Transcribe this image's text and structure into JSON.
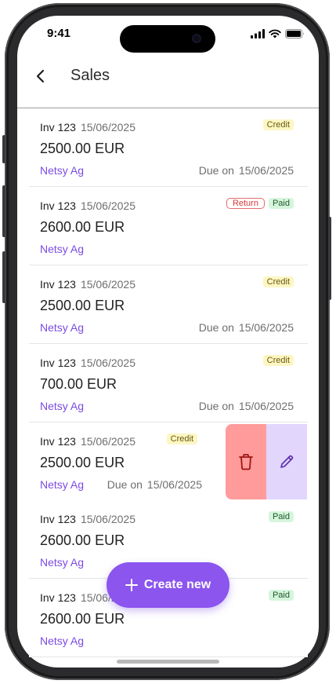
{
  "status_bar": {
    "time": "9:41",
    "icons": [
      "signal-icon",
      "wifi-icon",
      "battery-icon"
    ]
  },
  "header": {
    "title": "Sales",
    "back_icon": "chevron-left-icon"
  },
  "invoices": [
    {
      "number": "Inv 123",
      "date": "15/06/2025",
      "amount": "2500.00 EUR",
      "company": "Netsy Ag",
      "due_label": "Due on",
      "due_date": "15/06/2025",
      "badges": [
        {
          "text": "Credit",
          "kind": "credit"
        }
      ]
    },
    {
      "number": "Inv 123",
      "date": "15/06/2025",
      "amount": "2600.00 EUR",
      "company": "Netsy Ag",
      "due_label": "",
      "due_date": "",
      "badges": [
        {
          "text": "Return",
          "kind": "return"
        },
        {
          "text": "Paid",
          "kind": "paid"
        }
      ]
    },
    {
      "number": "Inv 123",
      "date": "15/06/2025",
      "amount": "2500.00 EUR",
      "company": "Netsy Ag",
      "due_label": "Due on",
      "due_date": "15/06/2025",
      "badges": [
        {
          "text": "Credit",
          "kind": "credit"
        }
      ]
    },
    {
      "number": "Inv 123",
      "date": "15/06/2025",
      "amount": "700.00 EUR",
      "company": "Netsy Ag",
      "due_label": "Due on",
      "due_date": "15/06/2025",
      "badges": [
        {
          "text": "Credit",
          "kind": "credit"
        }
      ]
    },
    {
      "number": "Inv 123",
      "date": "15/06/2025",
      "amount": "2500.00 EUR",
      "company": "Netsy Ag",
      "due_label": "Due on",
      "due_date": "15/06/2025",
      "badges": [
        {
          "text": "Credit",
          "kind": "credit"
        }
      ],
      "swiped": true
    },
    {
      "number": "Inv 123",
      "date": "15/06/2025",
      "amount": "2600.00 EUR",
      "company": "Netsy Ag",
      "due_label": "",
      "due_date": "",
      "badges": [
        {
          "text": "Paid",
          "kind": "paid"
        }
      ]
    },
    {
      "number": "Inv 123",
      "date": "15/06/2025",
      "amount": "2600.00 EUR",
      "company": "Netsy Ag",
      "due_label": "",
      "due_date": "",
      "badges": [
        {
          "text": "Paid",
          "kind": "paid"
        }
      ]
    }
  ],
  "swipe_actions": {
    "delete_icon": "trash-icon",
    "edit_icon": "pencil-icon"
  },
  "fab": {
    "label": "Create new",
    "icon": "plus-icon"
  },
  "colors": {
    "accent": "#8b55ee",
    "company_text": "#7b4ae2",
    "delete_action": "#ff9b9b",
    "edit_action": "#e2d6fc",
    "credit_badge": "#fdf6c3",
    "paid_badge": "#d6f5dc",
    "return_badge_border": "#e66b6d"
  }
}
